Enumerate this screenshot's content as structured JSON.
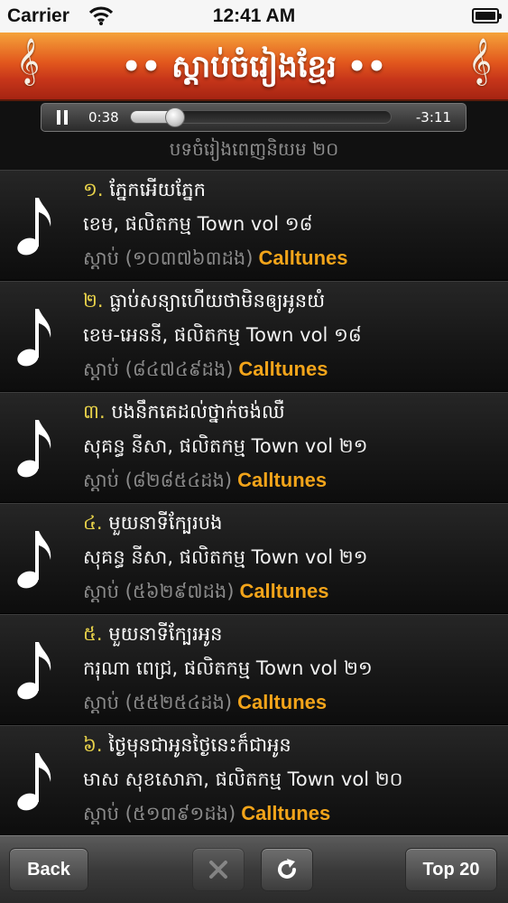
{
  "status_bar": {
    "carrier": "Carrier",
    "time": "12:41 AM"
  },
  "header": {
    "title": "•• ស្ដាប់ចំរៀងខ្មែរ ••",
    "left_icon": "treble-clef-icon",
    "right_icon": "treble-clef-icon"
  },
  "player": {
    "elapsed": "0:38",
    "remaining": "-3:11",
    "progress": 0.17
  },
  "subtitle": "បទចំរៀងពេញនិយម ២០",
  "songs": [
    {
      "num": "១.",
      "title": "ភ្នែកអើយភ្នែក",
      "artist": "ខេម, ផលិតកម្ម  Town vol ១៨",
      "plays": "ស្ដាប់ (១០៣៧៦៣ដង)",
      "source": "Calltunes"
    },
    {
      "num": "២.",
      "title": "ធ្លាប់សន្យាហើយថាមិនឲ្យអូនយំ",
      "artist": "ខេម-អេននី, ផលិតកម្ម  Town vol ១៨",
      "plays": "ស្ដាប់ (៨៤៧៤៩ដង)",
      "source": "Calltunes"
    },
    {
      "num": "៣.",
      "title": "បងនឹកគេដល់ថ្នាក់ចង់ឈឺ",
      "artist": "សុគន្ធ នីសា, ផលិតកម្ម  Town vol ២១",
      "plays": "ស្ដាប់ (៨២៨៥៤ដង)",
      "source": "Calltunes"
    },
    {
      "num": "៤.",
      "title": "មួយនាទីក្បែរបង",
      "artist": "សុគន្ធ នីសា, ផលិតកម្ម  Town vol ២១",
      "plays": "ស្ដាប់ (៥៦២៩៧ដង)",
      "source": "Calltunes"
    },
    {
      "num": "៥.",
      "title": "មួយនាទីក្បែរអូន",
      "artist": "ករុណា ពេជ្រ, ផលិតកម្ម  Town vol ២១",
      "plays": "ស្ដាប់ (៥៥២៥៤ដង)",
      "source": "Calltunes"
    },
    {
      "num": "៦.",
      "title": "ថ្ងៃមុនជាអូនថ្ងៃនេះក៏ជាអូន",
      "artist": "មាស សុខសោភា, ផលិតកម្ម  Town vol ២០",
      "plays": "ស្ដាប់ (៥១៣៩១ដង)",
      "source": "Calltunes"
    }
  ],
  "toolbar": {
    "back_label": "Back",
    "top20_label": "Top 20",
    "close_icon": "close-icon",
    "refresh_icon": "refresh-icon"
  },
  "colors": {
    "accent_yellow": "#e8d24a",
    "source_orange": "#f2a41a",
    "header_orange": "#e2571d"
  }
}
